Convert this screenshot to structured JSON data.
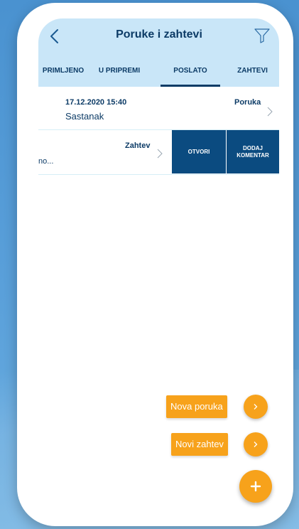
{
  "header": {
    "title": "Poruke i zahtevi",
    "back_icon": "chevron-left-icon",
    "filter_icon": "filter-icon"
  },
  "tabs": [
    {
      "label": "PRIMLJENO",
      "active": false
    },
    {
      "label": "U PRIPREMI",
      "active": false
    },
    {
      "label": "POSLATO",
      "active": true
    },
    {
      "label": "ZAHTEVI",
      "active": false
    }
  ],
  "list": [
    {
      "date": "17.12.2020 15:40",
      "subject": "Sastanak",
      "type": "Poruka"
    },
    {
      "subject": "no...",
      "type": "Zahtev",
      "actions": [
        "OTVORI",
        "DODAJ KOMENTAR"
      ]
    }
  ],
  "fab": {
    "new_message": "Nova poruka",
    "new_request": "Novi zahtev"
  },
  "colors": {
    "header_bg": "#c9e6f8",
    "primary": "#0c3b66",
    "action_bg": "#0b4b80",
    "accent": "#f7a21b"
  }
}
